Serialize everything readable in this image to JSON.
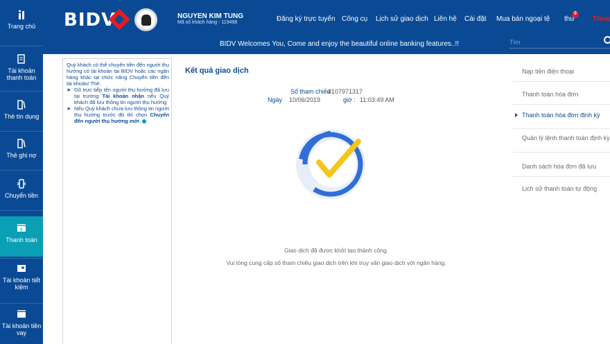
{
  "header": {
    "brand": "BIDV",
    "user_name": "NGUYEN KIM TUNG",
    "user_code": "Mã số khách hàng - 119498",
    "nav": [
      "Đăng ký trực tuyến",
      "Công cụ",
      "Lịch sử giao dịch",
      "Liên hệ",
      "Cài đặt",
      "Mua bán ngoại tệ",
      "thư"
    ],
    "notification_count": "0",
    "logout": "Thoát",
    "welcome": "BIDV Welcomes You, Come and enjoy the beautiful online banking features..!!",
    "search_placeholder": "Tìm"
  },
  "sidebar": {
    "items": [
      {
        "label": "Trang chủ",
        "icon": "home-icon"
      },
      {
        "label": "Tài khoản thanh toán",
        "icon": "account-icon"
      },
      {
        "label": "Thẻ tín dụng",
        "icon": "credit-card-icon"
      },
      {
        "label": "Thẻ ghi nợ",
        "icon": "debit-card-icon"
      },
      {
        "label": "Chuyển tiền",
        "icon": "transfer-icon"
      },
      {
        "label": "Thanh toán",
        "icon": "payment-icon"
      },
      {
        "label": "Tài khoản tiết kiệm",
        "icon": "savings-icon"
      },
      {
        "label": "Tài khoản tiền vay",
        "icon": "loan-icon"
      }
    ],
    "active_index": 5
  },
  "info": {
    "intro": "Quý khách có thể chuyển tiền đến người thụ hưởng có tài khoản tại BIDV hoặc các ngân hàng khác tại chức năng Chuyển tiền đến tài khoản/ Thẻ.",
    "b1_a": "Gõ trực tiếp tên người thụ hưởng đã lưu tại trường ",
    "b1_b": "Tài khoản nhận",
    "b1_c": " nếu Quý khách đã lưu thông tin người thụ hưởng",
    "b2_a": "Nếu Quý khách chưa lưu thông tin người thụ hưởng trước đó thì chọn ",
    "b2_b": "Chuyển đến người thụ hưởng mới",
    "b2_c": ".",
    "bullet_mark": "➤"
  },
  "main": {
    "title": "Kết quả giao dịch",
    "ref_label": "Số tham chiếu",
    "ref_value": "8107971317",
    "date_label": "Ngày",
    "date_value": "10/06/2019",
    "time_label": "giờ :",
    "time_value": "11:03:49 AM",
    "success_msg": "Giao dịch đã được khởi tạo thành công.",
    "ref_msg": "Vui lòng cung cấp số tham chiếu giao dịch trên khi truy vấn giao dịch với ngân hàng."
  },
  "right_menu": {
    "items": [
      "Nạp tiền điện thoại",
      "Thanh toán hóa đơn",
      "Thanh toán hóa đơn định kỳ",
      "Quản lý lệnh thanh toán định kỳ",
      "Danh sách hóa đơn đã lưu",
      "Lịch sử thanh toán tự động"
    ],
    "active_index": 2
  },
  "colors": {
    "brand_blue": "#0a4a95",
    "brand_red": "#e11e26",
    "active_teal": "#0a9fb5",
    "check_yellow": "#f5c518"
  }
}
